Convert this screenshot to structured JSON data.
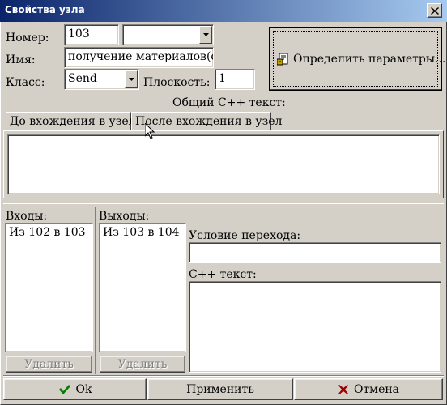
{
  "window": {
    "title": "Свойства узла",
    "close_icon": "close-icon"
  },
  "form": {
    "number_label": "Номер:",
    "number_value": "103",
    "number_dropdown_value": "",
    "name_label": "Имя:",
    "name_value": "получение материалов(сп)",
    "class_label": "Класс:",
    "class_value": "Send",
    "plane_label": "Плоскость:",
    "plane_value": "1",
    "define_params_label": "Определить параметры...",
    "define_params_icon": "document-params-icon"
  },
  "common_text": {
    "label": "Общий С++ текст:",
    "tabs": [
      {
        "label": "До вхождения в узел",
        "active": false
      },
      {
        "label": "После вхождения в узел",
        "active": true
      }
    ],
    "text_value": ""
  },
  "inputs": {
    "label": "Входы:",
    "items": [
      "Из 102 в 103"
    ],
    "delete_label": "Удалить"
  },
  "outputs": {
    "label": "Выходы:",
    "items": [
      "Из 103 в 104"
    ],
    "delete_label": "Удалить"
  },
  "transition": {
    "condition_label": "Условие перехода:",
    "condition_value": "",
    "cpp_label": "С++ текст:",
    "cpp_value": ""
  },
  "buttons": {
    "ok_label": "Ok",
    "apply_label": "Применить",
    "cancel_label": "Отмена"
  },
  "colors": {
    "title_start": "#0a246a",
    "title_end": "#a6caf0",
    "ok_check": "#008000",
    "cancel_x": "#a00000",
    "face": "#d4d0c8"
  }
}
